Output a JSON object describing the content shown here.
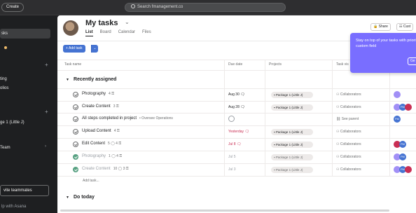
{
  "topbar": {
    "create_label": "Create",
    "search_placeholder": "Search fmanagement.co"
  },
  "sidebar": {
    "items": [
      {
        "label": "sks"
      },
      {
        "label": "ting"
      },
      {
        "label": "olios"
      },
      {
        "label": "ge 1 (Little J)"
      },
      {
        "label": "Team"
      }
    ],
    "invite_label": "vite teammates",
    "help_label": "lp with Asana"
  },
  "header": {
    "title": "My tasks",
    "tabs": [
      {
        "label": "List"
      },
      {
        "label": "Board"
      },
      {
        "label": "Calendar"
      },
      {
        "label": "Files"
      }
    ],
    "share_label": "Share",
    "customize_label": "Cust"
  },
  "toolbar": {
    "add_task_label": "+ Add task"
  },
  "popup": {
    "text": "Stay on top of your tasks with priority custom field",
    "button_label": "Ge"
  },
  "columns": {
    "task_name": "Task name",
    "due_date": "Due date",
    "projects": "Projects",
    "visibility": "Task vis"
  },
  "sections": [
    {
      "title": "Recently assigned"
    },
    {
      "title": "Do today"
    }
  ],
  "tasks": [
    {
      "name": "Photography",
      "meta": "4 ⚿",
      "project_label": "",
      "due": "Aug 30",
      "project": "Package 1 (Little J)",
      "collab": "Collaborators",
      "done": false
    },
    {
      "name": "Create Content",
      "meta": "3 ⚿",
      "project_label": "",
      "due": "Aug 28",
      "project": "Package 1 (Little J)",
      "collab": "Collaborators",
      "done": false
    },
    {
      "name": "All steps completed in project",
      "meta": "",
      "project_label": "• Oversee Operations",
      "due": "",
      "project": "",
      "collab": "See parent",
      "done": false
    },
    {
      "name": "Upload Content",
      "meta": "4 ⚿",
      "project_label": "",
      "due": "Yesterday",
      "project": "Package 1 (Little J)",
      "collab": "Collaborators",
      "done": false
    },
    {
      "name": "Edit Content",
      "meta": "5 ◯ 4 ⚿",
      "project_label": "",
      "due": "Jul 8",
      "project": "Package 1 (Little J)",
      "collab": "Collaborators",
      "done": false
    },
    {
      "name": "Photography",
      "meta": "1 ◯ 4 ⚿",
      "project_label": "",
      "due": "Jul 5",
      "project": "Package 1 (Little J)",
      "collab": "Collaborators",
      "done": true
    },
    {
      "name": "Create Content",
      "meta": "10 ◯ 3 ⚿",
      "project_label": "",
      "due": "Jul 3",
      "project": "Package 1 (Little J)",
      "collab": "Collaborators",
      "done": true
    }
  ],
  "add_task_row": "Add task...",
  "avatars": {
    "fm_label": "FM",
    "colors": {
      "purple": "#a18ff6",
      "blue": "#4573d2",
      "red": "#c92f54"
    }
  }
}
